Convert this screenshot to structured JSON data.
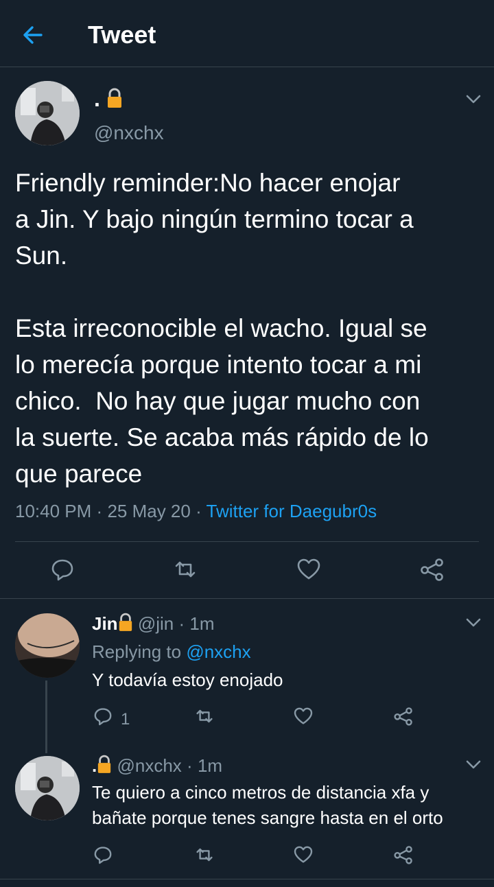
{
  "header": {
    "title": "Tweet"
  },
  "main_tweet": {
    "display_name": ".",
    "handle": "@nxchx",
    "body": "Friendly reminder:No hacer enojar\na Jin. Y bajo ningún termino tocar a\nSun.\n\nEsta irreconocible el wacho. Igual se\nlo merecía porque intento tocar a mi\nchico.  No hay que jugar mucho con\nla suerte. Se acaba más rápido de lo\nque parece",
    "time": "10:40 PM",
    "date": "25 May 20",
    "separator": "·",
    "source": "Twitter for Daegubr0s"
  },
  "replies": [
    {
      "display_name": "Jin",
      "handle": "@jin",
      "time": "1m",
      "replying_label": "Replying to",
      "replying_handle": "@nxchx",
      "text": "Y todavía estoy enojado",
      "reply_count": "1"
    },
    {
      "display_name": ".",
      "handle": "@nxchx",
      "time": "1m",
      "text": "Te quiero a cinco metros de distancia xfa y\nbañate porque tenes sangre hasta en el orto"
    }
  ],
  "colors": {
    "background": "#15202b",
    "accent": "#1da1f2",
    "muted": "#8899a6",
    "divider": "#38444d",
    "lock": "#f5a623"
  },
  "icons": [
    "back-arrow-icon",
    "lock-icon",
    "chevron-down-icon",
    "reply-icon",
    "retweet-icon",
    "like-icon",
    "share-icon"
  ]
}
